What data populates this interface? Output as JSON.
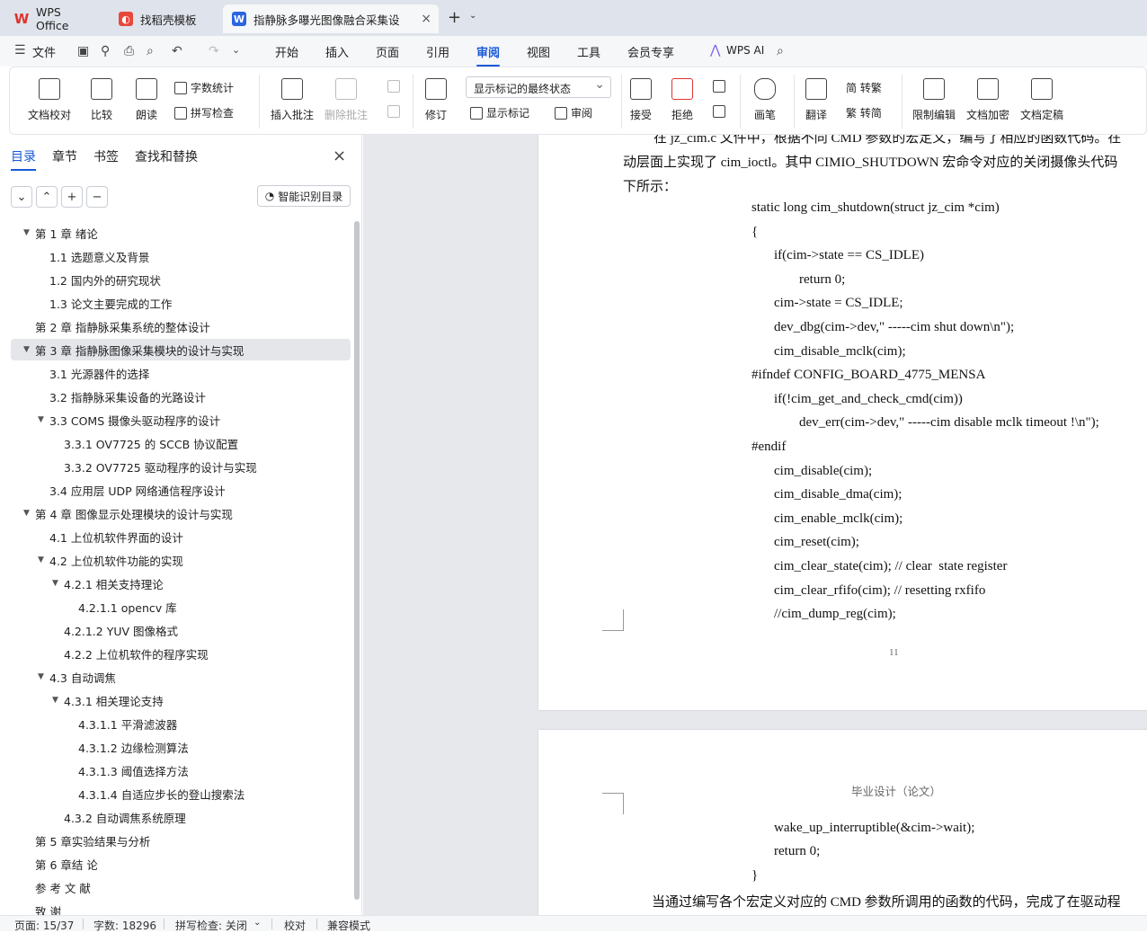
{
  "tabs": [
    {
      "label": "WPS Office"
    },
    {
      "label": "找稻壳模板"
    },
    {
      "label": "指静脉多曝光图像融合采集设"
    }
  ],
  "menu": {
    "file": "文件",
    "items": [
      "开始",
      "插入",
      "页面",
      "引用",
      "审阅",
      "视图",
      "工具",
      "会员专享"
    ],
    "active": "审阅",
    "ai": "WPS AI"
  },
  "ribbon": {
    "doc_check": "文档校对",
    "compare": "比较",
    "read_aloud": "朗读",
    "word_count": "字数统计",
    "spell_check": "拼写检查",
    "insert_comment": "插入批注",
    "delete_comment": "删除批注",
    "revise": "修订",
    "display_state": "显示标记的最终状态",
    "show_markup": "显示标记",
    "review": "审阅",
    "accept": "接受",
    "reject": "拒绝",
    "pen": "画笔",
    "translate": "翻译",
    "to_traditional": "简 转繁",
    "to_simplified": "繁 转简",
    "restrict_edit": "限制编辑",
    "encrypt": "文档加密",
    "finalize": "文档定稿"
  },
  "panel": {
    "tabs": [
      "目录",
      "章节",
      "书签",
      "查找和替换"
    ],
    "smart_btn": "智能识别目录",
    "toc": [
      {
        "text": "第 1 章  绪论",
        "level": 0,
        "exp": true
      },
      {
        "text": "1.1  选题意义及背景",
        "level": 1
      },
      {
        "text": "1.2  国内外的研究现状",
        "level": 1
      },
      {
        "text": "1.3  论文主要完成的工作",
        "level": 1
      },
      {
        "text": "第 2 章  指静脉采集系统的整体设计",
        "level": 0
      },
      {
        "text": "第 3 章  指静脉图像采集模块的设计与实现",
        "level": 0,
        "exp": true,
        "sel": true
      },
      {
        "text": "3.1  光源器件的选择",
        "level": 1
      },
      {
        "text": "3.2  指静脉采集设备的光路设计",
        "level": 1
      },
      {
        "text": "3.3 COMS 摄像头驱动程序的设计",
        "level": 1,
        "exp": true
      },
      {
        "text": "3.3.1 OV7725 的 SCCB 协议配置",
        "level": 2
      },
      {
        "text": "3.3.2 OV7725 驱动程序的设计与实现",
        "level": 2
      },
      {
        "text": "3.4  应用层 UDP 网络通信程序设计",
        "level": 1
      },
      {
        "text": "第 4 章  图像显示处理模块的设计与实现",
        "level": 0,
        "exp": true
      },
      {
        "text": "4.1  上位机软件界面的设计",
        "level": 1
      },
      {
        "text": "4.2  上位机软件功能的实现",
        "level": 1,
        "exp": true
      },
      {
        "text": "4.2.1  相关支持理论",
        "level": 2,
        "exp": true
      },
      {
        "text": "4.2.1.1 opencv 库",
        "level": 3
      },
      {
        "text": "4.2.1.2 YUV 图像格式",
        "level": 2
      },
      {
        "text": "4.2.2  上位机软件的程序实现",
        "level": 2
      },
      {
        "text": "4.3  自动调焦",
        "level": 1,
        "exp": true
      },
      {
        "text": "4.3.1  相关理论支持",
        "level": 2,
        "exp": true
      },
      {
        "text": "4.3.1.1  平滑滤波器",
        "level": 3
      },
      {
        "text": "4.3.1.2  边缘检测算法",
        "level": 3
      },
      {
        "text": "4.3.1.3 阈值选择方法",
        "level": 3
      },
      {
        "text": "4.3.1.4  自适应步长的登山搜索法",
        "level": 3
      },
      {
        "text": "4.3.2 自动调焦系统原理",
        "level": 2
      },
      {
        "text": "第 5 章实验结果与分析",
        "level": 0
      },
      {
        "text": "第 6 章结  论",
        "level": 0
      },
      {
        "text": "参  考  文  献",
        "level": 0
      },
      {
        "text": "致   谢",
        "level": 0
      }
    ]
  },
  "doc": {
    "para1": "在 jz_cim.c 文件中，根据不同 CMD 参数的宏定义，编写了相应的函数代码。在",
    "para2": "动层面上实现了 cim_ioctl。其中 CIMIO_SHUTDOWN 宏命令对应的关闭摄像头代码",
    "para3": "下所示：",
    "code": [
      "static long cim_shutdown(struct jz_cim *cim)",
      "{",
      "if(cim->state == CS_IDLE)",
      "return 0;",
      "cim->state = CS_IDLE;",
      "dev_dbg(cim->dev,\" -----cim shut down\\n\");",
      "cim_disable_mclk(cim);",
      "#ifndef CONFIG_BOARD_4775_MENSA",
      "if(!cim_get_and_check_cmd(cim))",
      "dev_err(cim->dev,\" -----cim disable mclk timeout !\\n\");",
      "#endif",
      "cim_disable(cim);",
      "cim_disable_dma(cim);",
      "cim_enable_mclk(cim);",
      "cim_reset(cim);",
      "cim_clear_state(cim); // clear  state register",
      "cim_clear_rfifo(cim); // resetting rxfifo",
      "//cim_dump_reg(cim);"
    ],
    "page_number": "11",
    "header2": "毕业设计（论文）",
    "code2": [
      "wake_up_interruptible(&cim->wait);",
      "return 0;",
      "}"
    ],
    "para4": "当通过编写各个宏定义对应的 CMD 参数所调用的函数的代码，完成了在驱动程"
  },
  "status": {
    "page": "页面: 15/37",
    "words": "字数: 18296",
    "spell": "拼写检查: 关闭",
    "proof": "校对",
    "compat": "兼容模式"
  }
}
